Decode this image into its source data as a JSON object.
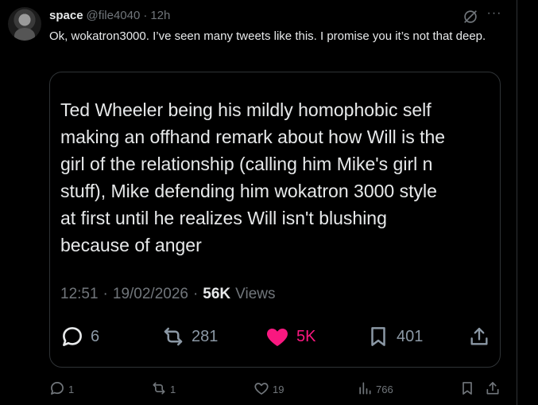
{
  "tweet": {
    "author_name": "space",
    "author_handle": "@file4040",
    "separator": "·",
    "time": "12h",
    "text": "Ok, wokatron3000. I’ve seen many tweets like this. I promise you it’s not that deep.",
    "more_label": "···"
  },
  "quote": {
    "text": "Ted Wheeler being his mildly homophobic self\nmaking an offhand remark about how Will is the\ngirl of the relationship (calling him Mike's girl n\nstuff), Mike defending him wokatron 3000 style\nat first until he realizes Will isn't blushing\nbecause of anger",
    "time": "12:51",
    "date": "19/02/2026",
    "separator": "·",
    "views_count": "56K",
    "views_label": "Views",
    "actions": {
      "replies": "6",
      "reposts": "281",
      "likes": "5K",
      "bookmarks": "401"
    },
    "like_color": "#f91880"
  },
  "actions": {
    "replies": "1",
    "reposts": "1",
    "likes": "19",
    "views": "766"
  },
  "icons": {
    "header": [
      "grok-icon",
      "more-icon"
    ],
    "quote_actions": [
      "reply-icon",
      "repost-icon",
      "like-icon-filled",
      "bookmark-icon",
      "share-icon"
    ],
    "tweet_actions": [
      "reply-icon",
      "repost-icon",
      "like-icon",
      "views-icon",
      "bookmark-icon",
      "share-icon"
    ]
  }
}
